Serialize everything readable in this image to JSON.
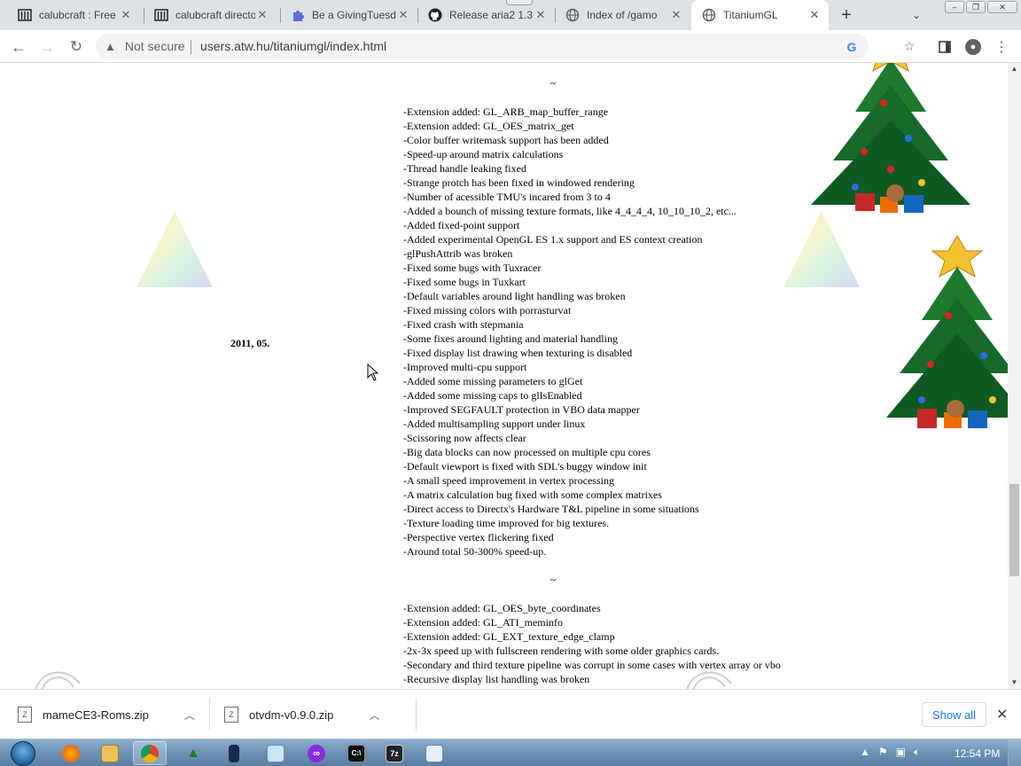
{
  "tabs": [
    {
      "title": "calubcraft : Free",
      "icon": "archive-icon",
      "active": false
    },
    {
      "title": "calubcraft directo",
      "icon": "archive-icon",
      "active": false
    },
    {
      "title": "Be a GivingTuesd",
      "icon": "puzzle-icon",
      "active": false
    },
    {
      "title": "Release aria2 1.3",
      "icon": "github-icon",
      "active": false
    },
    {
      "title": "Index of /gamo",
      "icon": "globe-icon",
      "active": false
    },
    {
      "title": "TitaniumGL",
      "icon": "globe-icon",
      "active": true
    }
  ],
  "toolbar": {
    "security_label": "Not secure",
    "url": "users.atw.hu/titaniumgl/index.html"
  },
  "page": {
    "date_label": "2011, 05.",
    "entries_top": [
      "-Extension added: GL_ARB_map_buffer_range",
      "-Extension added: GL_OES_matrix_get",
      "-Color buffer writemask support has been added",
      "-Speed-up around matrix calculations",
      "-Thread handle leaking fixed",
      "-Strange protch has been fixed in windowed rendering",
      "-Number of acessible TMU's incared from 3 to 4",
      "-Added a bounch of missing texture formats, like 4_4_4_4, 10_10_10_2, etc...",
      "-Added fixed-point support",
      "-Added experimental OpenGL ES 1.x support and ES context creation",
      "-glPushAttrib was broken",
      "-Fixed some bugs with Tuxracer",
      "-Fixed some bugs in Tuxkart",
      "-Default variables around light handling was broken",
      "-Fixed missing colors with porrasturvat",
      "-Fixed crash with stepmania",
      "-Some fixes around lighting and material handling",
      "-Fixed display list drawing when texturing is disabled",
      "-Improved multi-cpu support",
      "-Added some missing parameters to glGet",
      "-Added some missing caps to glIsEnabled",
      "-Improved SEGFAULT protection in VBO data mapper",
      "-Added multisampling support under linux",
      "-Scissoring now affects clear",
      "-Big data blocks can now processed on multiple cpu cores",
      "-Default viewport is fixed with SDL's buggy window init",
      "-A small speed improvement in vertex processing",
      "-A matrix calculation bug fixed with some complex matrixes",
      "-Direct access to Directx's Hardware T&L pipeline in some situations",
      "-Texture loading time improved for big textures.",
      "-Perspective vertex flickering fixed",
      "-Around total 50-300% speed-up."
    ],
    "entries_bottom": [
      "-Extension added: GL_OES_byte_coordinates",
      "-Extension added: GL_ATI_meminfo",
      "-Extension added: GL_EXT_texture_edge_clamp",
      "-2x-3x speed up with fullscreen rendering with some older graphics cards.",
      "-Secondary and third texture pipeline was corrupt in some cases with vertex array or vbo",
      "-Recursive display list handling was broken"
    ],
    "separator": "~"
  },
  "downloads": {
    "items": [
      {
        "filename": "mameCE3-Roms.zip"
      },
      {
        "filename": "otvdm-v0.9.0.zip"
      }
    ],
    "show_all_label": "Show all"
  },
  "taskbar": {
    "clock": "12:54 PM",
    "apps": [
      "firefox-icon",
      "file-explorer-icon",
      "chrome-icon",
      "tree-app-icon",
      "bottle-app-icon",
      "notepad-icon",
      "purple-app-icon",
      "cmd-icon",
      "7zip-icon",
      "window-app-icon"
    ]
  }
}
